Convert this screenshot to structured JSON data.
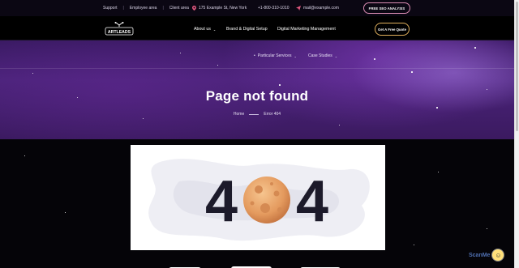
{
  "topbar": {
    "links": [
      "Support",
      "Employee area",
      "Client area"
    ],
    "address": "175 Example St, New York",
    "phone": "+1-800-310-1010",
    "email": "mail@example.com",
    "seo_button": "FREE SEO ANALYSIS"
  },
  "nav": {
    "logo_text": "ARTLEADS",
    "items": [
      "About us",
      "Brand & Digital Setup",
      "Digital Marketing Management"
    ],
    "quote_button": "Get A Free Quote"
  },
  "hero": {
    "subnav": [
      "Particular Services",
      "Case Studies"
    ],
    "title": "Page not found",
    "breadcrumb": {
      "home": "Home",
      "current": "Error 404"
    }
  },
  "error_graphic": {
    "left_digit": "4",
    "right_digit": "4"
  },
  "badge": {
    "text": "ScanMe"
  },
  "colors": {
    "accent_pink": "#d98bb1",
    "accent_gold": "#e0b05c",
    "hero_purple": "#4a2379",
    "moon": "#e8a869"
  }
}
